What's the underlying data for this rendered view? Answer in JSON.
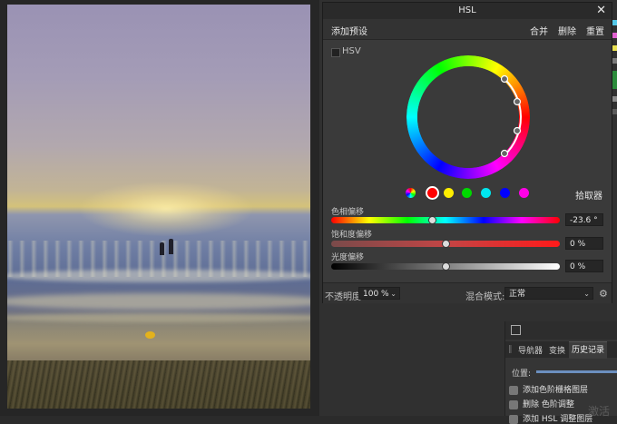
{
  "dialog": {
    "title": "HSL",
    "close_glyph": "✕",
    "toolbar": {
      "add_preset": "添加预设",
      "merge": "合并",
      "delete": "删除",
      "reset": "重置"
    },
    "hsv_label": "HSV",
    "swatches": [
      "master-icon",
      "red",
      "yellow",
      "green",
      "cyan",
      "blue",
      "magenta"
    ],
    "pick_label": "拾取器",
    "sliders": {
      "hue": {
        "label": "色相偏移",
        "value": "-23.6 °",
        "position": 0.44
      },
      "saturation": {
        "label": "饱和度偏移",
        "value": "0 %",
        "position": 0.5
      },
      "lightness": {
        "label": "光度偏移",
        "value": "0 %",
        "position": 0.5
      }
    },
    "footer": {
      "opacity_label": "不透明度:",
      "opacity_value": "100 %",
      "blend_label": "混合模式:",
      "blend_value": "正常"
    }
  },
  "history_panel": {
    "tabs": {
      "navigator": "导航器",
      "transform": "变换",
      "history": "历史记录"
    },
    "position_label": "位置:",
    "items": [
      "添加色阶栅格图层",
      "删除 色阶调整",
      "添加 HSL 调整图层"
    ]
  },
  "watermark": "激活"
}
